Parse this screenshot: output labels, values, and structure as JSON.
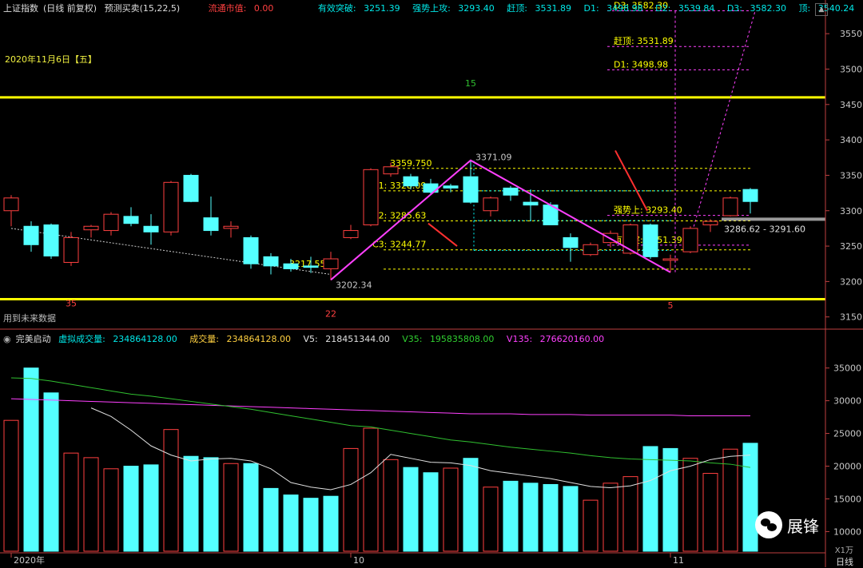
{
  "header": {
    "index_name": "上证指数",
    "period_info": "(日线 前复权)",
    "indicator": "预测买卖(15,22,5)",
    "float_mv_label": "流通市值: ",
    "float_mv_value": "0.00",
    "breakout_label": "有效突破: ",
    "breakout_value": "3251.39",
    "strong_label": "强势上攻: ",
    "strong_value": "3293.40",
    "chase_label": "赶顶: ",
    "chase_value": "3531.89",
    "d1_label": "D1: ",
    "d1_value": "3498.98",
    "d2_label": "D2: ",
    "d2_value": "3539.84",
    "d3_label": "D3: ",
    "d3_value": "3582.30",
    "top_label": "顶: ",
    "top_value": "3540.24"
  },
  "date_label": "2020年11月6日【五】",
  "future_label": "用到未来数据",
  "volume_header": {
    "name": "完美启动",
    "virtual_label": "虚拟成交量: ",
    "virtual_value": "234864128.00",
    "vol_label": "成交量: ",
    "vol_value": "234864128.00",
    "v5_label": "V5: ",
    "v5_value": "218451344.00",
    "v35_label": "V35: ",
    "v35_value": "195835808.00",
    "v135_label": "V135: ",
    "v135_value": "276620160.00"
  },
  "footer": {
    "unit": "X1万",
    "period": "日线"
  },
  "watermark": "展锋",
  "colors": {
    "up": "#ff4040",
    "down": "#54ffff",
    "yellow": "#ffff00",
    "magenta": "#ff40ff",
    "cyan": "#00ffff",
    "green": "#30c030",
    "white": "#e0e0e0",
    "axis": "#c04040"
  },
  "chart_data": [
    {
      "type": "candlestick",
      "ylim": [
        3135,
        3575
      ],
      "y_ticks": [
        3150,
        3200,
        3250,
        3300,
        3350,
        3400,
        3450,
        3500,
        3550
      ],
      "candles": [
        {
          "o": 3300,
          "h": 3322,
          "l": 3278,
          "c": 3318
        },
        {
          "o": 3278,
          "h": 3285,
          "l": 3242,
          "c": 3252
        },
        {
          "o": 3280,
          "h": 3282,
          "l": 3232,
          "c": 3236
        },
        {
          "o": 3227,
          "h": 3270,
          "l": 3222,
          "c": 3262
        },
        {
          "o": 3273,
          "h": 3280,
          "l": 3262,
          "c": 3278
        },
        {
          "o": 3272,
          "h": 3298,
          "l": 3265,
          "c": 3295
        },
        {
          "o": 3292,
          "h": 3305,
          "l": 3278,
          "c": 3282
        },
        {
          "o": 3278,
          "h": 3295,
          "l": 3252,
          "c": 3270
        },
        {
          "o": 3270,
          "h": 3342,
          "l": 3265,
          "c": 3340
        },
        {
          "o": 3350,
          "h": 3352,
          "l": 3312,
          "c": 3313
        },
        {
          "o": 3290,
          "h": 3320,
          "l": 3265,
          "c": 3272
        },
        {
          "o": 3275,
          "h": 3285,
          "l": 3262,
          "c": 3278
        },
        {
          "o": 3262,
          "h": 3265,
          "l": 3218,
          "c": 3225
        },
        {
          "o": 3235,
          "h": 3240,
          "l": 3210,
          "c": 3222
        },
        {
          "o": 3225,
          "h": 3232,
          "l": 3214,
          "c": 3218
        },
        {
          "o": 3222,
          "h": 3235,
          "l": 3212,
          "c": 3220
        },
        {
          "o": 3218,
          "h": 3242,
          "l": 3202,
          "c": 3232
        },
        {
          "o": 3262,
          "h": 3280,
          "l": 3260,
          "c": 3272
        },
        {
          "o": 3280,
          "h": 3360,
          "l": 3278,
          "c": 3358
        },
        {
          "o": 3352,
          "h": 3368,
          "l": 3348,
          "c": 3362
        },
        {
          "o": 3348,
          "h": 3352,
          "l": 3330,
          "c": 3335
        },
        {
          "o": 3338,
          "h": 3345,
          "l": 3322,
          "c": 3326
        },
        {
          "o": 3335,
          "h": 3338,
          "l": 3326,
          "c": 3332
        },
        {
          "o": 3348,
          "h": 3371,
          "l": 3310,
          "c": 3312
        },
        {
          "o": 3300,
          "h": 3320,
          "l": 3292,
          "c": 3318
        },
        {
          "o": 3332,
          "h": 3335,
          "l": 3314,
          "c": 3322
        },
        {
          "o": 3312,
          "h": 3330,
          "l": 3285,
          "c": 3308
        },
        {
          "o": 3308,
          "h": 3312,
          "l": 3280,
          "c": 3280
        },
        {
          "o": 3262,
          "h": 3268,
          "l": 3228,
          "c": 3248
        },
        {
          "o": 3238,
          "h": 3255,
          "l": 3236,
          "c": 3252
        },
        {
          "o": 3255,
          "h": 3272,
          "l": 3248,
          "c": 3268
        },
        {
          "o": 3240,
          "h": 3282,
          "l": 3238,
          "c": 3280
        },
        {
          "o": 3280,
          "h": 3282,
          "l": 3232,
          "c": 3235
        },
        {
          "o": 3230,
          "h": 3238,
          "l": 3213,
          "c": 3232
        },
        {
          "o": 3242,
          "h": 3278,
          "l": 3240,
          "c": 3275
        },
        {
          "o": 3280,
          "h": 3288,
          "l": 3270,
          "c": 3285
        },
        {
          "o": 3293,
          "h": 3320,
          "l": 3292,
          "c": 3318
        },
        {
          "o": 3330,
          "h": 3332,
          "l": 3296,
          "c": 3313
        }
      ],
      "levels": [
        {
          "value": 3460,
          "style": "solid",
          "label": ""
        },
        {
          "value": 3175,
          "style": "solid",
          "label": ""
        },
        {
          "value": 3359.75,
          "style": "dotted",
          "label": "3359.750"
        },
        {
          "value": 3328.09,
          "style": "dotted",
          "label": "C1: 3328.09"
        },
        {
          "value": 3285.63,
          "style": "dotted",
          "label": "C2: 3285.63"
        },
        {
          "value": 3244.77,
          "style": "dotted",
          "label": "C3: 3244.77"
        },
        {
          "value": 3217.55,
          "style": "dotted",
          "label": "3217.55"
        },
        {
          "value": 3293.4,
          "style": "dotted",
          "label": "强势上: 3293.40"
        },
        {
          "value": 3251.39,
          "style": "dotted",
          "label": "有效突: 3251.39"
        },
        {
          "value": 3531.89,
          "style": "dotted",
          "label": "赶顶: 3531.89"
        },
        {
          "value": 3498.98,
          "style": "dotted",
          "label": "D1: 3498.98"
        },
        {
          "value": 3582.3,
          "style": "dotted",
          "label": "D3: 3582.30"
        }
      ],
      "zigzag": [
        {
          "i": 16,
          "v": 3202.34,
          "label": "3202.34"
        },
        {
          "i": 23,
          "v": 3371.09,
          "label": "3371.09"
        },
        {
          "i": 33,
          "v": 3213,
          "label": ""
        }
      ],
      "counters": [
        {
          "i": 3,
          "v": 3165,
          "label": "35",
          "color": "#ff4040"
        },
        {
          "i": 23,
          "v": 3476,
          "label": "15",
          "color": "#30c030"
        },
        {
          "i": 16,
          "v": 3150,
          "label": "22",
          "color": "#ff4040"
        },
        {
          "i": 33,
          "v": 3162,
          "label": "5",
          "color": "#ff4040"
        }
      ],
      "range_label": "3286.62 - 3291.60"
    },
    {
      "type": "bar",
      "ylim": [
        7000,
        38500
      ],
      "y_ticks": [
        10000,
        15000,
        20000,
        25000,
        30000,
        35000
      ],
      "x_labels": [
        {
          "i": 0,
          "label": "2020年"
        },
        {
          "i": 17,
          "label": "10"
        },
        {
          "i": 33,
          "label": "11"
        }
      ],
      "values": [
        27000,
        35000,
        31200,
        22000,
        21300,
        19600,
        20000,
        20200,
        25600,
        21500,
        21300,
        20400,
        20400,
        16600,
        15600,
        15100,
        15400,
        22700,
        25800,
        21000,
        19800,
        19000,
        19700,
        21200,
        16800,
        17700,
        17400,
        17200,
        16900,
        14800,
        17400,
        18400,
        23000,
        22700,
        21200,
        18900,
        22600,
        23500
      ],
      "up": [
        true,
        false,
        false,
        true,
        true,
        true,
        false,
        false,
        true,
        false,
        false,
        true,
        false,
        false,
        false,
        false,
        false,
        true,
        true,
        true,
        false,
        false,
        true,
        false,
        true,
        false,
        false,
        false,
        false,
        true,
        true,
        true,
        false,
        false,
        true,
        true,
        true,
        false
      ],
      "ma5": [
        null,
        null,
        null,
        null,
        28900,
        27600,
        25500,
        23100,
        21700,
        20800,
        21100,
        21200,
        20800,
        19600,
        17500,
        16800,
        16400,
        17200,
        19000,
        21800,
        21200,
        20600,
        20500,
        20100,
        19300,
        18900,
        18500,
        18100,
        17500,
        16900,
        16700,
        17000,
        17800,
        19300,
        20000,
        21000,
        21500,
        21700
      ],
      "ma35": [
        33500,
        33400,
        33000,
        32500,
        32000,
        31500,
        31000,
        30700,
        30300,
        29900,
        29500,
        29100,
        28700,
        28200,
        27700,
        27200,
        26700,
        26200,
        26000,
        25500,
        25000,
        24500,
        24000,
        23700,
        23300,
        22900,
        22600,
        22300,
        22000,
        21600,
        21300,
        21100,
        21000,
        20900,
        20800,
        20500,
        20300,
        19800
      ],
      "ma135": [
        30300,
        30200,
        30100,
        30000,
        29900,
        29800,
        29700,
        29600,
        29500,
        29400,
        29300,
        29200,
        29100,
        29000,
        28900,
        28800,
        28700,
        28600,
        28500,
        28400,
        28300,
        28200,
        28100,
        28000,
        28000,
        28000,
        27900,
        27900,
        27900,
        27800,
        27800,
        27800,
        27800,
        27800,
        27700,
        27700,
        27700,
        27700
      ]
    }
  ]
}
